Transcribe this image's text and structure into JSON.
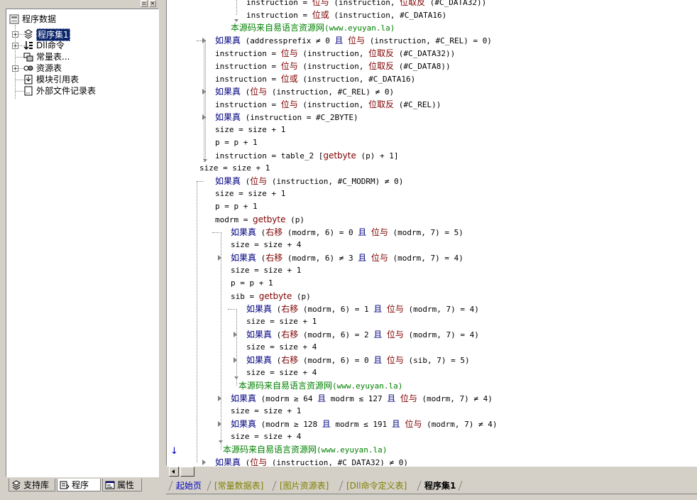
{
  "left_panel": {
    "tree": {
      "root": "程序数据",
      "items": [
        {
          "label": "程序集1",
          "icon": "assembly-icon",
          "expandable": true,
          "selected": true
        },
        {
          "label": "Dll命令",
          "icon": "dll-icon",
          "expandable": true
        },
        {
          "label": "常量表...",
          "icon": "constant-icon",
          "expandable": false
        },
        {
          "label": "资源表",
          "icon": "resource-icon",
          "expandable": true
        },
        {
          "label": "模块引用表",
          "icon": "module-icon",
          "expandable": false
        },
        {
          "label": "外部文件记录表",
          "icon": "file-record-icon",
          "expandable": false
        }
      ]
    },
    "tabs": [
      {
        "label": "支持库",
        "icon": "library-icon"
      },
      {
        "label": "程序",
        "icon": "program-icon"
      },
      {
        "label": "属性",
        "icon": "properties-icon"
      }
    ]
  },
  "code": {
    "lines": [
      {
        "indent": 3,
        "parts": [
          [
            "t",
            "instruction = "
          ],
          [
            "f",
            "位与"
          ],
          [
            "t",
            " (instruction, "
          ],
          [
            "f",
            "位取反"
          ],
          [
            "t",
            " (#C_DATA32))"
          ]
        ]
      },
      {
        "indent": 3,
        "parts": [
          [
            "t",
            "instruction = "
          ],
          [
            "f",
            "位或"
          ],
          [
            "t",
            " (instruction, #C_DATA16)"
          ]
        ]
      },
      {
        "indent": 2,
        "parts": [
          [
            "c",
            "本源码来自易语言资源网"
          ],
          [
            "g",
            "(www.eyuyan.la)"
          ]
        ]
      },
      {
        "indent": 1,
        "parts": [
          [
            "k",
            "如果真"
          ],
          [
            "t",
            " (addressprefix ≠ 0 "
          ],
          [
            "k",
            "且"
          ],
          [
            "t",
            " "
          ],
          [
            "f",
            "位与"
          ],
          [
            "t",
            " (instruction, #C_REL) = 0)"
          ]
        ]
      },
      {
        "indent": 1,
        "parts": [
          [
            "t",
            "instruction = "
          ],
          [
            "f",
            "位与"
          ],
          [
            "t",
            " (instruction, "
          ],
          [
            "f",
            "位取反"
          ],
          [
            "t",
            " (#C_DATA32))"
          ]
        ]
      },
      {
        "indent": 1,
        "parts": [
          [
            "t",
            "instruction = "
          ],
          [
            "f",
            "位与"
          ],
          [
            "t",
            " (instruction, "
          ],
          [
            "f",
            "位取反"
          ],
          [
            "t",
            " (#C_DATA8))"
          ]
        ]
      },
      {
        "indent": 1,
        "parts": [
          [
            "t",
            "instruction = "
          ],
          [
            "f",
            "位或"
          ],
          [
            "t",
            " (instruction, #C_DATA16)"
          ]
        ]
      },
      {
        "indent": 1,
        "parts": [
          [
            "k",
            "如果真"
          ],
          [
            "t",
            " ("
          ],
          [
            "f",
            "位与"
          ],
          [
            "t",
            " (instruction, #C_REL) ≠ 0)"
          ]
        ]
      },
      {
        "indent": 1,
        "parts": [
          [
            "t",
            "instruction = "
          ],
          [
            "f",
            "位与"
          ],
          [
            "t",
            " (instruction, "
          ],
          [
            "f",
            "位取反"
          ],
          [
            "t",
            " (#C_REL))"
          ]
        ]
      },
      {
        "indent": 1,
        "parts": [
          [
            "k",
            "如果真"
          ],
          [
            "t",
            " (instruction = #C_2BYTE)"
          ]
        ]
      },
      {
        "indent": 1,
        "parts": [
          [
            "t",
            "size = size + 1"
          ]
        ]
      },
      {
        "indent": 1,
        "parts": [
          [
            "t",
            "p = p + 1"
          ]
        ]
      },
      {
        "indent": 1,
        "parts": [
          [
            "t",
            "instruction = table_2 ["
          ],
          [
            "f",
            "getbyte"
          ],
          [
            "t",
            " (p) + 1]"
          ]
        ]
      },
      {
        "indent": 0,
        "parts": [
          [
            "t",
            "size = size + 1"
          ]
        ]
      },
      {
        "indent": 1,
        "parts": [
          [
            "k",
            "如果真"
          ],
          [
            "t",
            " ("
          ],
          [
            "f",
            "位与"
          ],
          [
            "t",
            " (instruction, #C_MODRM) ≠ 0)"
          ]
        ]
      },
      {
        "indent": 1,
        "parts": [
          [
            "t",
            "size = size + 1"
          ]
        ]
      },
      {
        "indent": 1,
        "parts": [
          [
            "t",
            "p = p + 1"
          ]
        ]
      },
      {
        "indent": 1,
        "parts": [
          [
            "t",
            "modrm = "
          ],
          [
            "f",
            "getbyte"
          ],
          [
            "t",
            " (p)"
          ]
        ]
      },
      {
        "indent": 2,
        "parts": [
          [
            "k",
            "如果真"
          ],
          [
            "t",
            " ("
          ],
          [
            "f",
            "右移"
          ],
          [
            "t",
            " (modrm, 6) = 0 "
          ],
          [
            "k",
            "且"
          ],
          [
            "t",
            " "
          ],
          [
            "f",
            "位与"
          ],
          [
            "t",
            " (modrm, 7) = 5)"
          ]
        ]
      },
      {
        "indent": 2,
        "parts": [
          [
            "t",
            "size = size + 4"
          ]
        ]
      },
      {
        "indent": 2,
        "parts": [
          [
            "k",
            "如果真"
          ],
          [
            "t",
            " ("
          ],
          [
            "f",
            "右移"
          ],
          [
            "t",
            " (modrm, 6) ≠ 3 "
          ],
          [
            "k",
            "且"
          ],
          [
            "t",
            " "
          ],
          [
            "f",
            "位与"
          ],
          [
            "t",
            " (modrm, 7) = 4)"
          ]
        ]
      },
      {
        "indent": 2,
        "parts": [
          [
            "t",
            "size = size + 1"
          ]
        ]
      },
      {
        "indent": 2,
        "parts": [
          [
            "t",
            "p = p + 1"
          ]
        ]
      },
      {
        "indent": 2,
        "parts": [
          [
            "t",
            "sib = "
          ],
          [
            "f",
            "getbyte"
          ],
          [
            "t",
            " (p)"
          ]
        ]
      },
      {
        "indent": 3,
        "parts": [
          [
            "k",
            "如果真"
          ],
          [
            "t",
            " ("
          ],
          [
            "f",
            "右移"
          ],
          [
            "t",
            " (modrm, 6) = 1 "
          ],
          [
            "k",
            "且"
          ],
          [
            "t",
            " "
          ],
          [
            "f",
            "位与"
          ],
          [
            "t",
            " (modrm, 7) = 4)"
          ]
        ]
      },
      {
        "indent": 3,
        "parts": [
          [
            "t",
            "size = size + 1"
          ]
        ]
      },
      {
        "indent": 3,
        "parts": [
          [
            "k",
            "如果真"
          ],
          [
            "t",
            " ("
          ],
          [
            "f",
            "右移"
          ],
          [
            "t",
            " (modrm, 6) = 2 "
          ],
          [
            "k",
            "且"
          ],
          [
            "t",
            " "
          ],
          [
            "f",
            "位与"
          ],
          [
            "t",
            " (modrm, 7) = 4)"
          ]
        ]
      },
      {
        "indent": 3,
        "parts": [
          [
            "t",
            "size = size + 4"
          ]
        ]
      },
      {
        "indent": 3,
        "parts": [
          [
            "k",
            "如果真"
          ],
          [
            "t",
            " ("
          ],
          [
            "f",
            "右移"
          ],
          [
            "t",
            " (modrm, 6) = 0 "
          ],
          [
            "k",
            "且"
          ],
          [
            "t",
            " "
          ],
          [
            "f",
            "位与"
          ],
          [
            "t",
            " (sib, 7) = 5)"
          ]
        ]
      },
      {
        "indent": 3,
        "parts": [
          [
            "t",
            "size = size + 4"
          ]
        ]
      },
      {
        "indent": 2.5,
        "parts": [
          [
            "c",
            "本源码来自易语言资源网"
          ],
          [
            "g",
            "(www.eyuyan.la)"
          ]
        ]
      },
      {
        "indent": 2,
        "parts": [
          [
            "k",
            "如果真"
          ],
          [
            "t",
            " (modrm ≥ 64 "
          ],
          [
            "k",
            "且"
          ],
          [
            "t",
            " modrm ≤ 127 "
          ],
          [
            "k",
            "且"
          ],
          [
            "t",
            " "
          ],
          [
            "f",
            "位与"
          ],
          [
            "t",
            " (modrm, 7) ≠ 4)"
          ]
        ]
      },
      {
        "indent": 2,
        "parts": [
          [
            "t",
            "size = size + 1"
          ]
        ]
      },
      {
        "indent": 2,
        "parts": [
          [
            "k",
            "如果真"
          ],
          [
            "t",
            " (modrm ≥ 128 "
          ],
          [
            "k",
            "且"
          ],
          [
            "t",
            " modrm ≤ 191 "
          ],
          [
            "k",
            "且"
          ],
          [
            "t",
            " "
          ],
          [
            "f",
            "位与"
          ],
          [
            "t",
            " (modrm, 7) ≠ 4)"
          ]
        ]
      },
      {
        "indent": 2,
        "parts": [
          [
            "t",
            "size = size + 4"
          ]
        ]
      },
      {
        "indent": 1.5,
        "parts": [
          [
            "c",
            "本源码来自易语言资源网"
          ],
          [
            "g",
            "(www.eyuyan.la)"
          ]
        ]
      },
      {
        "indent": 1,
        "parts": [
          [
            "k",
            "如果真"
          ],
          [
            "t",
            " ("
          ],
          [
            "f",
            "位与"
          ],
          [
            "t",
            " (instruction, #C_DATA32) ≠ 0)"
          ]
        ]
      }
    ]
  },
  "bottom_tabs": [
    {
      "label": "起始页",
      "color": "#0000c0"
    },
    {
      "label": "[常量数据表]",
      "color": "#808000"
    },
    {
      "label": "[图片资源表]",
      "color": "#808000"
    },
    {
      "label": "[Dll命令定义表]",
      "color": "#808000"
    },
    {
      "label": "程序集1",
      "color": "#000000",
      "active": true
    }
  ]
}
